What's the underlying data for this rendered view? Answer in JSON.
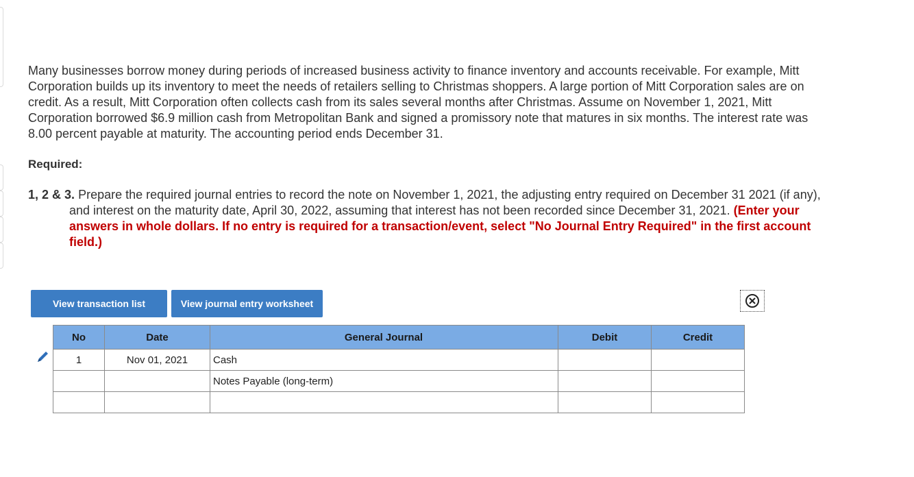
{
  "problem": {
    "intro": "Many businesses borrow money during periods of increased business activity to finance inventory and accounts receivable. For example, Mitt Corporation builds up its inventory to meet the needs of retailers selling to Christmas shoppers. A large portion of Mitt Corporation sales are on credit. As a result, Mitt Corporation often collects cash from its sales several months after Christmas. Assume on November 1, 2021, Mitt Corporation borrowed $6.9 million cash from Metropolitan Bank and signed a promissory note that matures in six months. The interest rate was 8.00 percent payable at maturity. The accounting period ends December 31."
  },
  "required": {
    "heading": "Required:",
    "item_number": "1, 2 & 3.",
    "item_text": "Prepare the required journal entries to record the note on November 1, 2021, the adjusting entry required on December 31 2021 (if any), and interest on the maturity date, April 30, 2022, assuming that interest has not been recorded since December 31, 2021.",
    "instruction": "(Enter your answers in whole dollars. If no entry is required for a transaction/event, select \"No Journal Entry Required\" in the first account field.)"
  },
  "buttons": {
    "transaction_list": "View transaction list",
    "journal_worksheet": "View journal entry worksheet"
  },
  "journal": {
    "headers": {
      "no": "No",
      "date": "Date",
      "general_journal": "General Journal",
      "debit": "Debit",
      "credit": "Credit"
    },
    "rows": [
      {
        "no": "1",
        "date": "Nov 01, 2021",
        "account": "Cash",
        "debit": "",
        "credit": ""
      },
      {
        "no": "",
        "date": "",
        "account": "Notes Payable (long-term)",
        "debit": "",
        "credit": ""
      },
      {
        "no": "",
        "date": "",
        "account": "",
        "debit": "",
        "credit": ""
      }
    ]
  },
  "icons": {
    "edit": "pencil-icon",
    "close": "close-circle-icon"
  },
  "colors": {
    "button": "#3c7dc4",
    "table_header": "#7aabe4",
    "instruction_red": "#c00000"
  }
}
